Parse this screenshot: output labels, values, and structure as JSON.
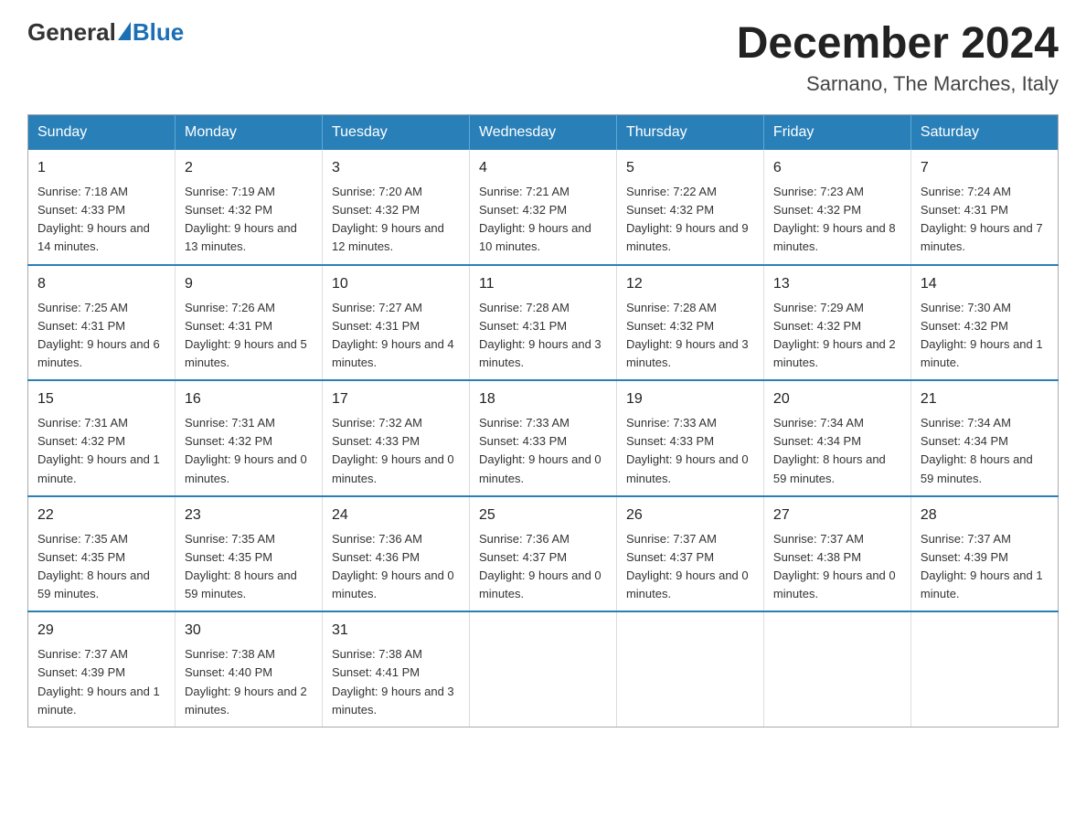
{
  "logo": {
    "general": "General",
    "blue": "Blue"
  },
  "title": "December 2024",
  "location": "Sarnano, The Marches, Italy",
  "days_of_week": [
    "Sunday",
    "Monday",
    "Tuesday",
    "Wednesday",
    "Thursday",
    "Friday",
    "Saturday"
  ],
  "weeks": [
    [
      {
        "day": "1",
        "sunrise": "7:18 AM",
        "sunset": "4:33 PM",
        "daylight": "9 hours and 14 minutes."
      },
      {
        "day": "2",
        "sunrise": "7:19 AM",
        "sunset": "4:32 PM",
        "daylight": "9 hours and 13 minutes."
      },
      {
        "day": "3",
        "sunrise": "7:20 AM",
        "sunset": "4:32 PM",
        "daylight": "9 hours and 12 minutes."
      },
      {
        "day": "4",
        "sunrise": "7:21 AM",
        "sunset": "4:32 PM",
        "daylight": "9 hours and 10 minutes."
      },
      {
        "day": "5",
        "sunrise": "7:22 AM",
        "sunset": "4:32 PM",
        "daylight": "9 hours and 9 minutes."
      },
      {
        "day": "6",
        "sunrise": "7:23 AM",
        "sunset": "4:32 PM",
        "daylight": "9 hours and 8 minutes."
      },
      {
        "day": "7",
        "sunrise": "7:24 AM",
        "sunset": "4:31 PM",
        "daylight": "9 hours and 7 minutes."
      }
    ],
    [
      {
        "day": "8",
        "sunrise": "7:25 AM",
        "sunset": "4:31 PM",
        "daylight": "9 hours and 6 minutes."
      },
      {
        "day": "9",
        "sunrise": "7:26 AM",
        "sunset": "4:31 PM",
        "daylight": "9 hours and 5 minutes."
      },
      {
        "day": "10",
        "sunrise": "7:27 AM",
        "sunset": "4:31 PM",
        "daylight": "9 hours and 4 minutes."
      },
      {
        "day": "11",
        "sunrise": "7:28 AM",
        "sunset": "4:31 PM",
        "daylight": "9 hours and 3 minutes."
      },
      {
        "day": "12",
        "sunrise": "7:28 AM",
        "sunset": "4:32 PM",
        "daylight": "9 hours and 3 minutes."
      },
      {
        "day": "13",
        "sunrise": "7:29 AM",
        "sunset": "4:32 PM",
        "daylight": "9 hours and 2 minutes."
      },
      {
        "day": "14",
        "sunrise": "7:30 AM",
        "sunset": "4:32 PM",
        "daylight": "9 hours and 1 minute."
      }
    ],
    [
      {
        "day": "15",
        "sunrise": "7:31 AM",
        "sunset": "4:32 PM",
        "daylight": "9 hours and 1 minute."
      },
      {
        "day": "16",
        "sunrise": "7:31 AM",
        "sunset": "4:32 PM",
        "daylight": "9 hours and 0 minutes."
      },
      {
        "day": "17",
        "sunrise": "7:32 AM",
        "sunset": "4:33 PM",
        "daylight": "9 hours and 0 minutes."
      },
      {
        "day": "18",
        "sunrise": "7:33 AM",
        "sunset": "4:33 PM",
        "daylight": "9 hours and 0 minutes."
      },
      {
        "day": "19",
        "sunrise": "7:33 AM",
        "sunset": "4:33 PM",
        "daylight": "9 hours and 0 minutes."
      },
      {
        "day": "20",
        "sunrise": "7:34 AM",
        "sunset": "4:34 PM",
        "daylight": "8 hours and 59 minutes."
      },
      {
        "day": "21",
        "sunrise": "7:34 AM",
        "sunset": "4:34 PM",
        "daylight": "8 hours and 59 minutes."
      }
    ],
    [
      {
        "day": "22",
        "sunrise": "7:35 AM",
        "sunset": "4:35 PM",
        "daylight": "8 hours and 59 minutes."
      },
      {
        "day": "23",
        "sunrise": "7:35 AM",
        "sunset": "4:35 PM",
        "daylight": "8 hours and 59 minutes."
      },
      {
        "day": "24",
        "sunrise": "7:36 AM",
        "sunset": "4:36 PM",
        "daylight": "9 hours and 0 minutes."
      },
      {
        "day": "25",
        "sunrise": "7:36 AM",
        "sunset": "4:37 PM",
        "daylight": "9 hours and 0 minutes."
      },
      {
        "day": "26",
        "sunrise": "7:37 AM",
        "sunset": "4:37 PM",
        "daylight": "9 hours and 0 minutes."
      },
      {
        "day": "27",
        "sunrise": "7:37 AM",
        "sunset": "4:38 PM",
        "daylight": "9 hours and 0 minutes."
      },
      {
        "day": "28",
        "sunrise": "7:37 AM",
        "sunset": "4:39 PM",
        "daylight": "9 hours and 1 minute."
      }
    ],
    [
      {
        "day": "29",
        "sunrise": "7:37 AM",
        "sunset": "4:39 PM",
        "daylight": "9 hours and 1 minute."
      },
      {
        "day": "30",
        "sunrise": "7:38 AM",
        "sunset": "4:40 PM",
        "daylight": "9 hours and 2 minutes."
      },
      {
        "day": "31",
        "sunrise": "7:38 AM",
        "sunset": "4:41 PM",
        "daylight": "9 hours and 3 minutes."
      },
      null,
      null,
      null,
      null
    ]
  ],
  "labels": {
    "sunrise": "Sunrise:",
    "sunset": "Sunset:",
    "daylight": "Daylight:"
  }
}
